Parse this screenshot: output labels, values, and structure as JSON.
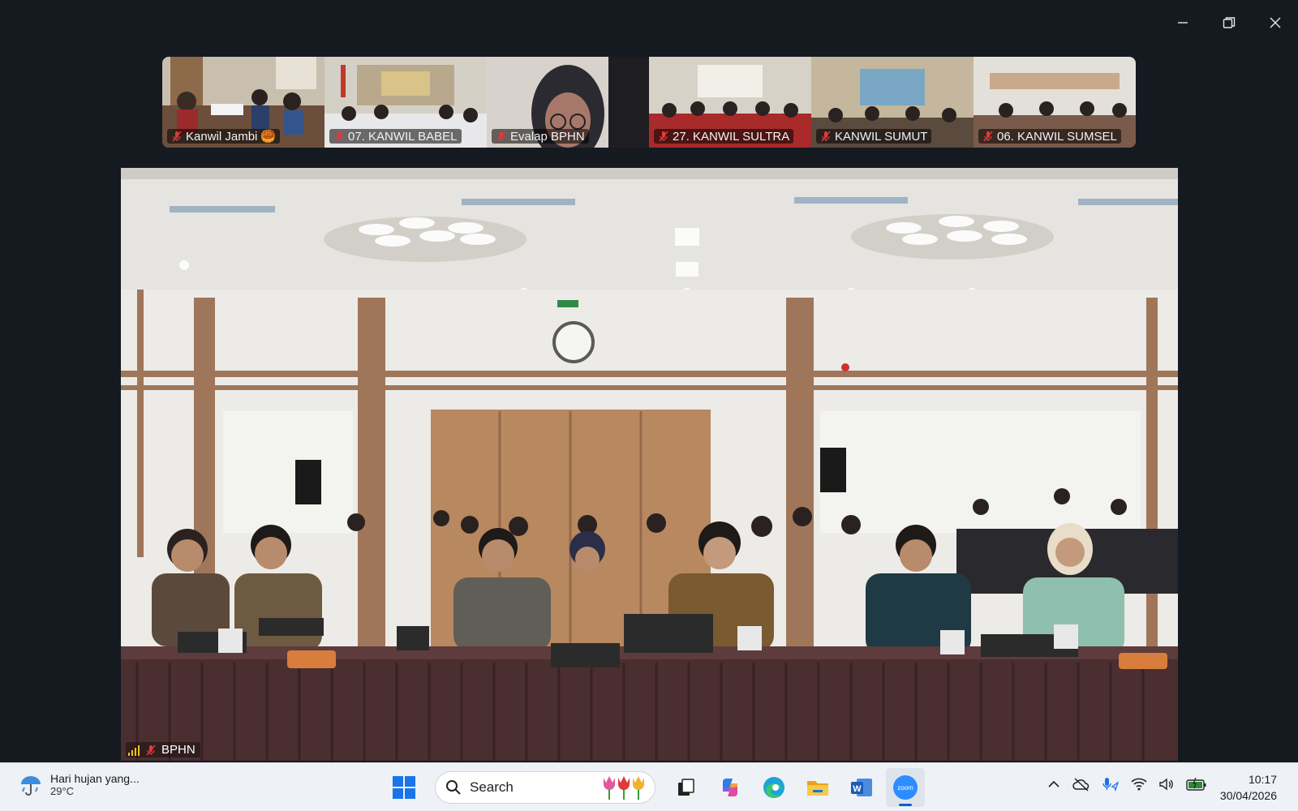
{
  "window": {
    "controls": [
      "minimize-icon",
      "restore-icon",
      "close-icon"
    ]
  },
  "participants": [
    {
      "name": "Kanwil Jambi",
      "emoji": "🥮",
      "muted": true
    },
    {
      "name": "07. KANWIL BABEL",
      "muted": true
    },
    {
      "name": "Evalap BPHN",
      "muted": true
    },
    {
      "name": "27. KANWIL SULTRA",
      "muted": true
    },
    {
      "name": "KANWIL SUMUT",
      "muted": true
    },
    {
      "name": "06. KANWIL SUMSEL",
      "muted": true
    }
  ],
  "main_video": {
    "name": "BPHN",
    "muted": true,
    "signal_icon": "signal-bars-icon"
  },
  "taskbar": {
    "weather_desc": "Hari hujan yang...",
    "weather_temp": "29°C",
    "search_placeholder": "Search",
    "apps": [
      "start-icon",
      "task-view-icon",
      "copilot-icon",
      "edge-icon",
      "file-explorer-icon",
      "word-icon",
      "zoom-icon"
    ],
    "time": "10:17",
    "date": "30/04/2026"
  },
  "colors": {
    "background": "#141a20",
    "taskbar": "#eef1f6",
    "accent": "#0a5fd0",
    "mute_red": "#e03a3a"
  }
}
